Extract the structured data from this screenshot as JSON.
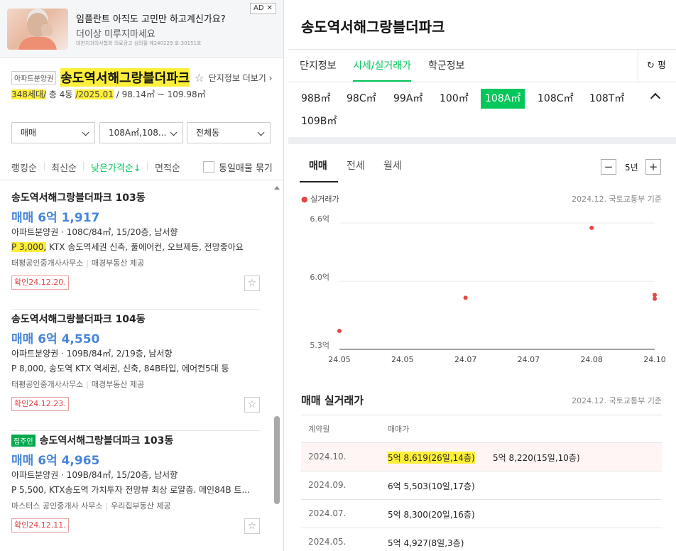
{
  "ad": {
    "title": "임플란트 아직도 고민만 하고계신가요?",
    "subtitle": "더이상 미루지마세요",
    "disclaimer": "대한치과의사협회 의료광고 심의필 제240229 호-30151호",
    "tag": "AD",
    "close": "✕"
  },
  "complex": {
    "type_badge": "아파트분양권",
    "name": "송도역서해그랑블더파크",
    "favorite_icon": "☆",
    "more_label": "단지정보 더보기 ›",
    "households": "348세대",
    "slash1": "/",
    "floors_pre": "총 4동",
    "slash2": "/",
    "completion": "2025.01",
    "area_range": "/ 98.14㎡ ~ 109.98㎡"
  },
  "filters": {
    "trade": "매매",
    "area": "108A㎡,108...",
    "building": "전체동"
  },
  "sort": {
    "ranking": "랭킹순",
    "latest": "최신순",
    "low_price": "낮은가격순↓",
    "area": "면적순",
    "group_label": "동일매물 묶기"
  },
  "listings": [
    {
      "badge": "",
      "title": "송도역서해그랑블더파크 103동",
      "price": "매매 6억 1,917",
      "spec": "아파트분양권 · 108C/84㎡, 15/20층, 남서향",
      "premium": "P 3,000,",
      "desc": " KTX 송도역세권 신축, 풀에어컨, 오브제등, 전망좋아요",
      "agent": "태평공인중개사사무소",
      "provider": "매경부동산 제공",
      "confirmed": "확인24.12.20."
    },
    {
      "badge": "",
      "title": "송도역서해그랑블더파크 104동",
      "price": "매매 6억 4,550",
      "spec": "아파트분양권 · 109B/84㎡, 2/19층, 남서향",
      "premium": "P 8,000,",
      "desc": " 송도역 KTX 역세권, 신축, 84B타입, 에어컨5대 등",
      "agent": "태평공인중개사사무소",
      "provider": "매경부동산 제공",
      "confirmed": "확인24.12.23."
    },
    {
      "badge": "집주인",
      "title": "송도역서해그랑블더파크 103동",
      "price": "매매 6억 4,965",
      "spec": "아파트분양권 · 109B/84㎡, 15/20층, 남서향",
      "premium": "P 5,500,",
      "desc": " KTX송도역 가치투자 전망뷰 최상 로얄층. 메인84B 트...",
      "agent": "마스터스 공인중개사 사무소",
      "provider": "우리집부동산 제공",
      "confirmed": "확인24.12.11."
    }
  ],
  "detail": {
    "title": "송도역서해그랑블더파크",
    "tabs": [
      "단지정보",
      "시세/실거래가",
      "학군정보"
    ],
    "refresh_label": "↻ 평",
    "areas": [
      "98B㎡",
      "98C㎡",
      "99A㎡",
      "100㎡",
      "108A㎡",
      "108C㎡",
      "108T㎡",
      "109B㎡"
    ],
    "trade_tabs": [
      "매매",
      "전세",
      "월세"
    ],
    "period_minus": "−",
    "period": "5년",
    "period_plus": "+"
  },
  "chart_data": {
    "type": "scatter",
    "legend": "실거래가",
    "source": "2024.12. 국토교통부 기준",
    "x_ticks": [
      "24.05",
      "24.05",
      "24.07",
      "24.07",
      "24.08",
      "24.10"
    ],
    "y_ticks": [
      "6.6억",
      "6.0억",
      "5.3억"
    ],
    "y_range": [
      5.3,
      6.6
    ],
    "color": "#e44545",
    "points": [
      {
        "x": "24.05",
        "y": 5.49
      },
      {
        "x": "24.07",
        "y": 5.83
      },
      {
        "x": "24.08",
        "y": 6.55
      },
      {
        "x": "24.10",
        "y": 5.86
      },
      {
        "x": "24.10",
        "y": 5.82
      }
    ]
  },
  "sales": {
    "title": "매매 실거래가",
    "source": "2024.12. 국토교통부 기준",
    "col_date": "계약월",
    "col_price": "매매가",
    "rows": [
      {
        "date": "2024.10.",
        "p1": "5억 8,619(26일,14층)",
        "p2": "5억 8,220(15일,10층)"
      },
      {
        "date": "2024.09.",
        "p1": "6억 5,503(10일,17층)",
        "p2": ""
      },
      {
        "date": "2024.07.",
        "p1": "5억 8,300(20일,16층)",
        "p2": ""
      },
      {
        "date": "2024.05.",
        "p1": "5억 4,927(8일,3층)",
        "p2": ""
      }
    ]
  }
}
